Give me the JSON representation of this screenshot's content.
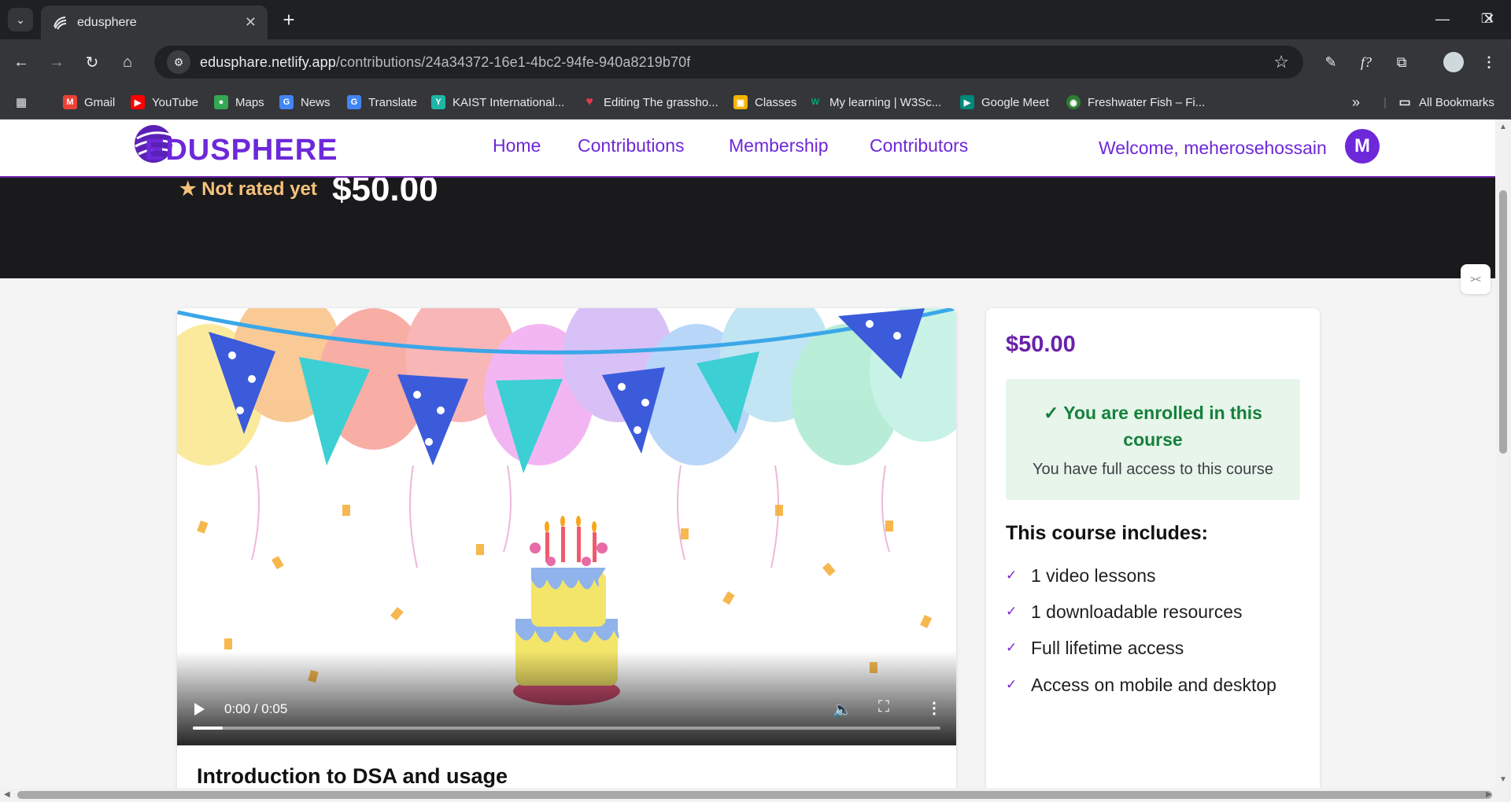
{
  "browser": {
    "tab_title": "edusphere",
    "url_host": "edusphare.netlify.app",
    "url_path": "/contributions/24a34372-16e1-4bc2-94fe-940a8219b70f",
    "bookmarks": [
      {
        "label": "Gmail",
        "icon": "gmail-icon",
        "color": "#ea4335"
      },
      {
        "label": "YouTube",
        "icon": "youtube-icon",
        "color": "#ff0000"
      },
      {
        "label": "Maps",
        "icon": "maps-icon",
        "color": "#34a853"
      },
      {
        "label": "News",
        "icon": "news-icon",
        "color": "#4285f4"
      },
      {
        "label": "Translate",
        "icon": "translate-icon",
        "color": "#4285f4"
      },
      {
        "label": "KAIST International...",
        "icon": "kaist-icon",
        "color": "#1fb5a7"
      },
      {
        "label": "Editing The grassho...",
        "icon": "heart-icon",
        "color": "#e53950"
      },
      {
        "label": "Classes",
        "icon": "classroom-icon",
        "color": "#f4b400"
      },
      {
        "label": "My learning | W3Sc...",
        "icon": "w3schools-icon",
        "color": "#04aa6d"
      },
      {
        "label": "Google Meet",
        "icon": "meet-icon",
        "color": "#00897b"
      },
      {
        "label": "Freshwater Fish – Fi...",
        "icon": "fish-icon",
        "color": "#2e7d32"
      }
    ],
    "all_bookmarks": "All Bookmarks"
  },
  "site": {
    "logo_text": "EDUSPHERE",
    "nav": [
      "Home",
      "Contributions",
      "Membership",
      "Contributors"
    ],
    "welcome": "Welcome, meherosehossain",
    "avatar_initial": "M"
  },
  "hero": {
    "rating": "★ Not rated yet",
    "price": "$50.00"
  },
  "video": {
    "time": "0:00 / 0:05",
    "progress": 0.04
  },
  "course": {
    "title": "Introduction to DSA and usage"
  },
  "sidebar": {
    "price": "$50.00",
    "enrolled_heading": "✓ You are enrolled in this course",
    "enrolled_sub": "You have full access to this course",
    "includes_heading": "This course includes:",
    "includes": [
      "1 video lessons",
      "1 downloadable resources",
      "Full lifetime access",
      "Access on mobile and desktop"
    ]
  }
}
